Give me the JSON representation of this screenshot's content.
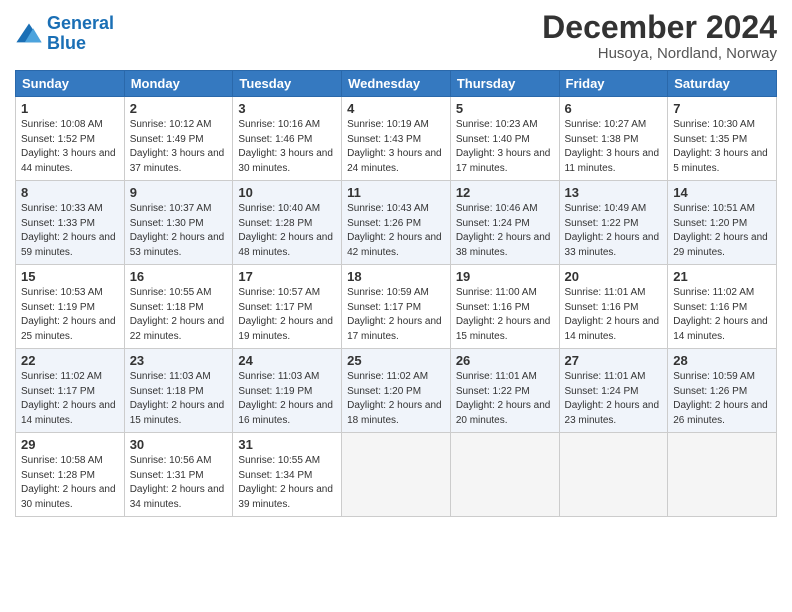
{
  "logo": {
    "line1": "General",
    "line2": "Blue"
  },
  "title": "December 2024",
  "location": "Husoya, Nordland, Norway",
  "days_of_week": [
    "Sunday",
    "Monday",
    "Tuesday",
    "Wednesday",
    "Thursday",
    "Friday",
    "Saturday"
  ],
  "weeks": [
    [
      {
        "day": "1",
        "sunrise": "10:08 AM",
        "sunset": "1:52 PM",
        "daylight": "3 hours and 44 minutes."
      },
      {
        "day": "2",
        "sunrise": "10:12 AM",
        "sunset": "1:49 PM",
        "daylight": "3 hours and 37 minutes."
      },
      {
        "day": "3",
        "sunrise": "10:16 AM",
        "sunset": "1:46 PM",
        "daylight": "3 hours and 30 minutes."
      },
      {
        "day": "4",
        "sunrise": "10:19 AM",
        "sunset": "1:43 PM",
        "daylight": "3 hours and 24 minutes."
      },
      {
        "day": "5",
        "sunrise": "10:23 AM",
        "sunset": "1:40 PM",
        "daylight": "3 hours and 17 minutes."
      },
      {
        "day": "6",
        "sunrise": "10:27 AM",
        "sunset": "1:38 PM",
        "daylight": "3 hours and 11 minutes."
      },
      {
        "day": "7",
        "sunrise": "10:30 AM",
        "sunset": "1:35 PM",
        "daylight": "3 hours and 5 minutes."
      }
    ],
    [
      {
        "day": "8",
        "sunrise": "10:33 AM",
        "sunset": "1:33 PM",
        "daylight": "2 hours and 59 minutes."
      },
      {
        "day": "9",
        "sunrise": "10:37 AM",
        "sunset": "1:30 PM",
        "daylight": "2 hours and 53 minutes."
      },
      {
        "day": "10",
        "sunrise": "10:40 AM",
        "sunset": "1:28 PM",
        "daylight": "2 hours and 48 minutes."
      },
      {
        "day": "11",
        "sunrise": "10:43 AM",
        "sunset": "1:26 PM",
        "daylight": "2 hours and 42 minutes."
      },
      {
        "day": "12",
        "sunrise": "10:46 AM",
        "sunset": "1:24 PM",
        "daylight": "2 hours and 38 minutes."
      },
      {
        "day": "13",
        "sunrise": "10:49 AM",
        "sunset": "1:22 PM",
        "daylight": "2 hours and 33 minutes."
      },
      {
        "day": "14",
        "sunrise": "10:51 AM",
        "sunset": "1:20 PM",
        "daylight": "2 hours and 29 minutes."
      }
    ],
    [
      {
        "day": "15",
        "sunrise": "10:53 AM",
        "sunset": "1:19 PM",
        "daylight": "2 hours and 25 minutes."
      },
      {
        "day": "16",
        "sunrise": "10:55 AM",
        "sunset": "1:18 PM",
        "daylight": "2 hours and 22 minutes."
      },
      {
        "day": "17",
        "sunrise": "10:57 AM",
        "sunset": "1:17 PM",
        "daylight": "2 hours and 19 minutes."
      },
      {
        "day": "18",
        "sunrise": "10:59 AM",
        "sunset": "1:17 PM",
        "daylight": "2 hours and 17 minutes."
      },
      {
        "day": "19",
        "sunrise": "11:00 AM",
        "sunset": "1:16 PM",
        "daylight": "2 hours and 15 minutes."
      },
      {
        "day": "20",
        "sunrise": "11:01 AM",
        "sunset": "1:16 PM",
        "daylight": "2 hours and 14 minutes."
      },
      {
        "day": "21",
        "sunrise": "11:02 AM",
        "sunset": "1:16 PM",
        "daylight": "2 hours and 14 minutes."
      }
    ],
    [
      {
        "day": "22",
        "sunrise": "11:02 AM",
        "sunset": "1:17 PM",
        "daylight": "2 hours and 14 minutes."
      },
      {
        "day": "23",
        "sunrise": "11:03 AM",
        "sunset": "1:18 PM",
        "daylight": "2 hours and 15 minutes."
      },
      {
        "day": "24",
        "sunrise": "11:03 AM",
        "sunset": "1:19 PM",
        "daylight": "2 hours and 16 minutes."
      },
      {
        "day": "25",
        "sunrise": "11:02 AM",
        "sunset": "1:20 PM",
        "daylight": "2 hours and 18 minutes."
      },
      {
        "day": "26",
        "sunrise": "11:01 AM",
        "sunset": "1:22 PM",
        "daylight": "2 hours and 20 minutes."
      },
      {
        "day": "27",
        "sunrise": "11:01 AM",
        "sunset": "1:24 PM",
        "daylight": "2 hours and 23 minutes."
      },
      {
        "day": "28",
        "sunrise": "10:59 AM",
        "sunset": "1:26 PM",
        "daylight": "2 hours and 26 minutes."
      }
    ],
    [
      {
        "day": "29",
        "sunrise": "10:58 AM",
        "sunset": "1:28 PM",
        "daylight": "2 hours and 30 minutes."
      },
      {
        "day": "30",
        "sunrise": "10:56 AM",
        "sunset": "1:31 PM",
        "daylight": "2 hours and 34 minutes."
      },
      {
        "day": "31",
        "sunrise": "10:55 AM",
        "sunset": "1:34 PM",
        "daylight": "2 hours and 39 minutes."
      },
      null,
      null,
      null,
      null
    ]
  ]
}
